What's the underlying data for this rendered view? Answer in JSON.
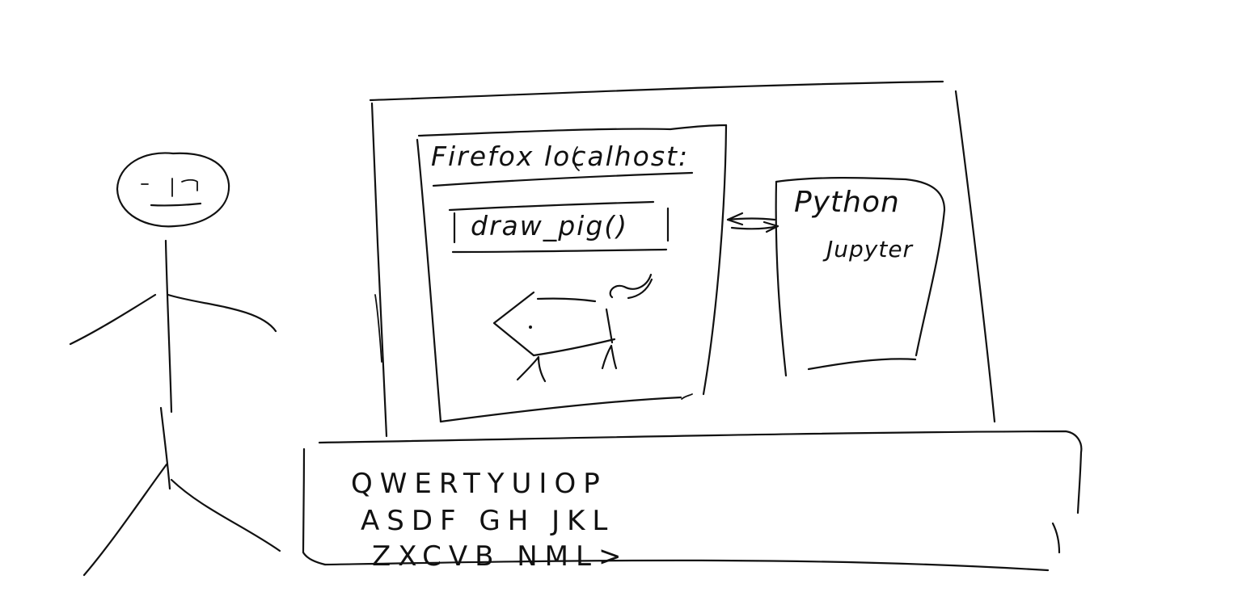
{
  "browser": {
    "title": "Firefox localhost:",
    "button_label": "draw_pig()"
  },
  "kernel": {
    "line1": "Python",
    "line2": "Jupyter"
  },
  "keyboard": {
    "row1": "QWERTYUIOP",
    "row2": "ASDF GH JKL",
    "row3": "ZXCVB NML>"
  },
  "icons": {
    "person": "stick-figure-icon",
    "pig": "pig-drawing-icon",
    "connection": "bidirectional-arrow-icon"
  },
  "colors": {
    "ink": "#111111",
    "paper": "#ffffff"
  }
}
